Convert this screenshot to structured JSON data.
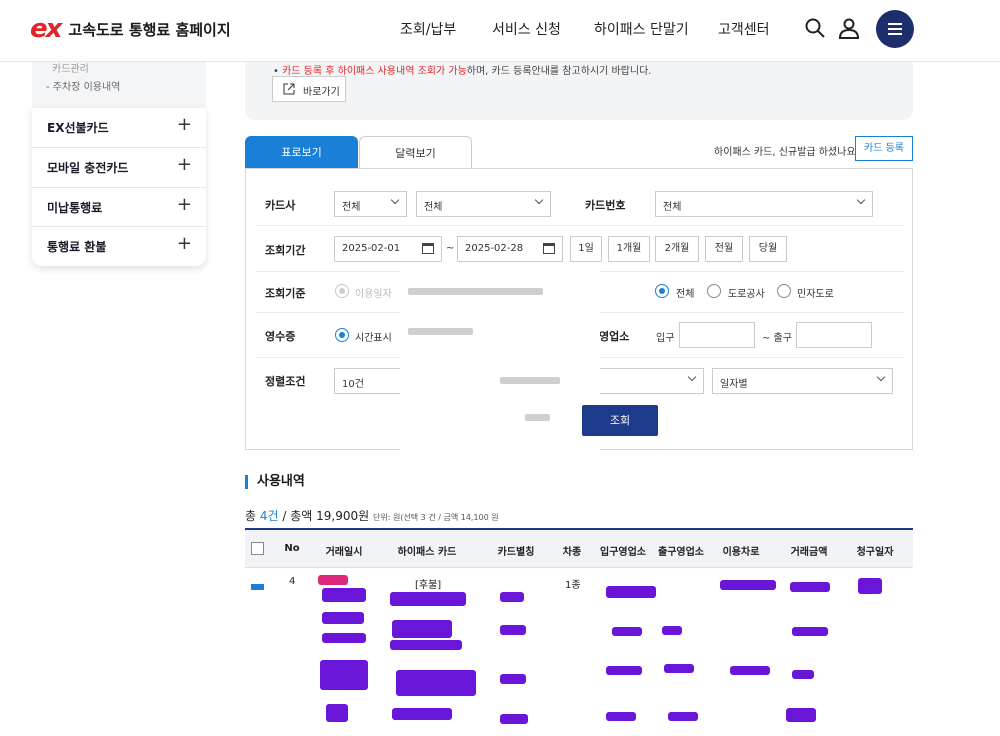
{
  "header": {
    "logo_mark": "ex",
    "site_title": "고속도로 통행료 홈페이지",
    "nav": [
      "조회/납부",
      "서비스 신청",
      "하이패스 단말기",
      "고객센터"
    ],
    "icons": [
      "search-icon",
      "user-icon",
      "menu-icon"
    ]
  },
  "sidebar": {
    "top_items": [
      "카드관리",
      "- 주차장 이용내역"
    ],
    "items": [
      {
        "label": "EX선불카드"
      },
      {
        "label": "모바일 충전카드"
      },
      {
        "label": "미납통행료"
      },
      {
        "label": "통행료 환불"
      }
    ]
  },
  "notice": {
    "bullet": "•",
    "red_text": "카드 등록 후 하이패스 사용내역 조회가 가능",
    "rest_text": "하며, 카드 등록안내를 참고하시기 바랍니다.",
    "shortcut_label": "바로가기"
  },
  "tabs": {
    "list": "표로보기",
    "calendar": "달력보기"
  },
  "card_prompt": "하이패스 카드, 신규발급 하셨나요?",
  "card_register": "카드 등록",
  "filter": {
    "card_company_label": "카드사",
    "card_company_1": "전체",
    "card_company_2": "전체",
    "card_number_label": "카드번호",
    "card_number_value": "전체",
    "period_label": "조회기간",
    "date_from": "2025-02-01",
    "date_sep": "~",
    "date_to": "2025-02-28",
    "period_buttons": [
      "1일",
      "1개월",
      "2개월",
      "전월",
      "당월"
    ],
    "basis_label": "조회기준",
    "basis_option": "이용일자",
    "road_options": [
      "전체",
      "도로공사",
      "민자도로"
    ],
    "receipt_label": "영수증",
    "receipt_option": "시간표시",
    "office_label_partial": "영업소",
    "entry_label": "입구",
    "exit_label": "~ 출구",
    "sort_label": "정렬조건",
    "sort_value": "10건",
    "sort_order": "일자별",
    "search_button": "조회"
  },
  "usage": {
    "title": "사용내역",
    "summary_prefix": "총 ",
    "count": "4건",
    "summary_mid": " / 총액 19,900원",
    "summary_unit": "단위: 원(선택 3 건 / 금액 14,100 원",
    "columns": [
      "No",
      "거래일시",
      "하이패스 카드",
      "카드별칭",
      "차종",
      "입구영업소",
      "출구영업소",
      "이용차로",
      "거래금액",
      "청구일자"
    ],
    "row1": {
      "no": "4",
      "card": "[후불]",
      "vehicle": "1종"
    }
  }
}
